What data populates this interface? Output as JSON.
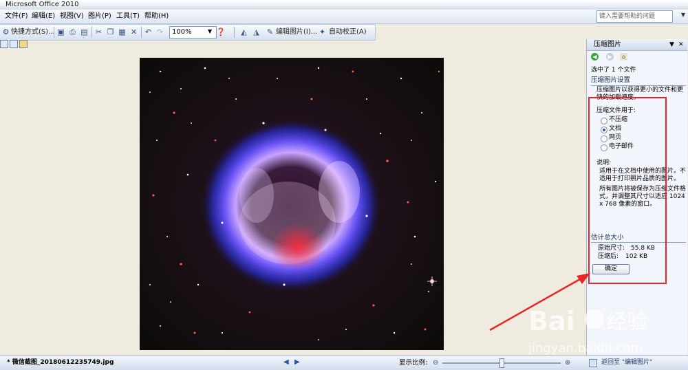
{
  "window": {
    "title": "Microsoft Office 2010"
  },
  "menubar": {
    "items": [
      "文件(F)",
      "编辑(E)",
      "视图(V)",
      "图片(P)",
      "工具(T)",
      "帮助(H)"
    ],
    "help_placeholder": "键入需要帮助的问题"
  },
  "toolbar": {
    "shortcut_label": "快捷方式(S)...",
    "zoom_value": "100%",
    "edit_picture_label": "编辑图片(I)...",
    "auto_correct_label": "自动校正(A)"
  },
  "pane": {
    "title": "压缩图片",
    "selected_info": "选中了 1 个文件",
    "settings_heading": "压缩图片设置",
    "settings_desc": "压缩图片以获得更小的文件和更快的加载速度。",
    "compress_for_label": "压缩文件用于:",
    "options": [
      "不压缩",
      "文档",
      "网页",
      "电子邮件"
    ],
    "selected_option": "文档",
    "explain_label": "说明:",
    "explain_text1": "适用于在文档中使用的图片。不适用于打印照片品质的图片。",
    "explain_text2": "所有图片将被保存为压缩文件格式，并调整其尺寸以适应 1024 x 768 像素的窗口。",
    "estimate_heading": "估计总大小",
    "original_size_label": "原始尺寸:",
    "original_size_value": "55.8 KB",
    "compressed_label": "压缩后:",
    "compressed_value": "102 KB",
    "ok_label": "确定"
  },
  "statusbar": {
    "file_name": "* 微信截图_20180612235749.jpg",
    "zoom_label": "显示比例:",
    "return_link": "返回至 \"编辑图片\""
  },
  "colors": {
    "highlight": "#e8262a",
    "pane_bg": "#f2f6fc",
    "canvas_bg": "#efebde"
  }
}
